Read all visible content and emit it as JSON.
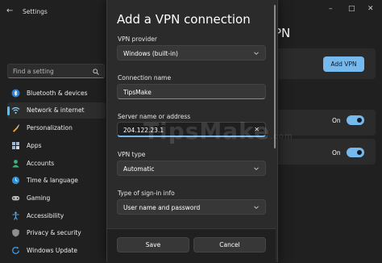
{
  "window": {
    "title": "Settings"
  },
  "sidebar": {
    "search_placeholder": "Find a setting",
    "items": [
      {
        "label": "Bluetooth & devices",
        "icon": "bluetooth-icon"
      },
      {
        "label": "Network & internet",
        "icon": "wifi-icon",
        "active": true
      },
      {
        "label": "Personalization",
        "icon": "brush-icon"
      },
      {
        "label": "Apps",
        "icon": "apps-icon"
      },
      {
        "label": "Accounts",
        "icon": "person-icon"
      },
      {
        "label": "Time & language",
        "icon": "globe-clock-icon"
      },
      {
        "label": "Gaming",
        "icon": "gamepad-icon"
      },
      {
        "label": "Accessibility",
        "icon": "accessibility-icon"
      },
      {
        "label": "Privacy & security",
        "icon": "shield-icon"
      },
      {
        "label": "Windows Update",
        "icon": "update-icon"
      }
    ]
  },
  "main": {
    "heading_fragment": "PN",
    "add_vpn_label": "Add VPN",
    "toggles": [
      {
        "label": "On",
        "on": true
      },
      {
        "label": "On",
        "on": true
      }
    ]
  },
  "dialog": {
    "title": "Add a VPN connection",
    "vpn_provider_label": "VPN provider",
    "vpn_provider_value": "Windows (built-in)",
    "connection_name_label": "Connection name",
    "connection_name_value": "TipsMake",
    "server_label": "Server name or address",
    "server_value": "204.122.23.1",
    "vpn_type_label": "VPN type",
    "vpn_type_value": "Automatic",
    "signin_label": "Type of sign-in info",
    "signin_value": "User name and password",
    "save_label": "Save",
    "cancel_label": "Cancel"
  },
  "watermark": {
    "text": "TipsMake",
    "suffix": ".com"
  },
  "colors": {
    "accent": "#76b9ed",
    "background": "#202020",
    "dialog": "#2b2b2b"
  }
}
